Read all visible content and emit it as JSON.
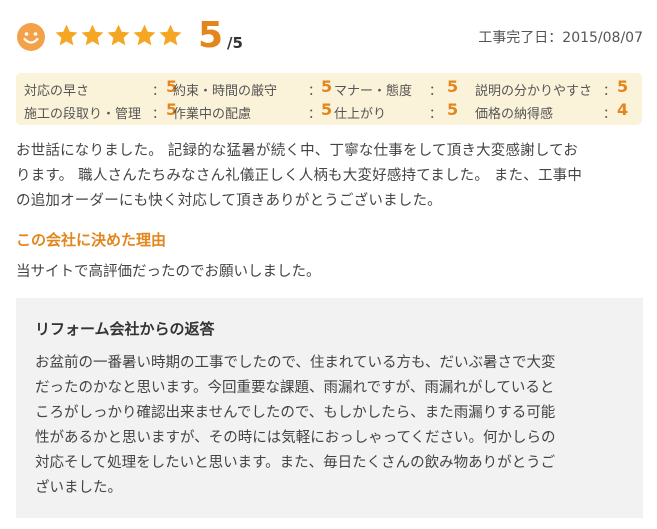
{
  "header": {
    "face_icon": "smiley-face-icon",
    "stars_filled": 5,
    "stars_total": 5,
    "score": "5",
    "score_max": "/5",
    "completion_label": "工事完了日：2015/08/07"
  },
  "ratings": [
    {
      "label": "対応の早さ",
      "value": "5"
    },
    {
      "label": "約束・時間の厳守",
      "value": "5"
    },
    {
      "label": "マナー・態度",
      "value": "5"
    },
    {
      "label": "説明の分かりやすさ",
      "value": "5"
    },
    {
      "label": "施工の段取り・管理",
      "value": "5"
    },
    {
      "label": "作業中の配慮",
      "value": "5"
    },
    {
      "label": "仕上がり",
      "value": "5"
    },
    {
      "label": "価格の納得感",
      "value": "4"
    }
  ],
  "comment": {
    "lines": [
      "お世話になりました。 記録的な猛暑が続く中、丁寧な仕事をして頂き大変感謝してお",
      "ります。 職人さんたちみなさん礼儀正しく人柄も大変好感持てました。 また、工事中",
      "の追加オーダーにも快く対応して頂きありがとうございました。"
    ]
  },
  "reason": {
    "title": "この会社に決めた理由",
    "text": "当サイトで高評価だったのでお願いしました。"
  },
  "reply": {
    "title": "リフォーム会社からの返答",
    "lines": [
      "お盆前の一番暑い時期の工事でしたので、住まれている方も、だいぶ暑さで大変",
      "だったのかなと思います。今回重要な課題、雨漏れですが、雨漏れがしていると",
      "ころがしっかり確認出来ませんでしたので、もしかしたら、また雨漏りする可能",
      "性があるかと思いますが、その時には気軽におっしゃってください。何かしらの",
      "対応そして処理をしたいと思います。また、毎日たくさんの飲み物ありがとうご",
      "ざいました。"
    ]
  },
  "colors": {
    "accent": "#e2861d",
    "star": "#f5a623",
    "ratings_bg": "#fbf3d9",
    "reply_bg": "#f2f2f2"
  }
}
